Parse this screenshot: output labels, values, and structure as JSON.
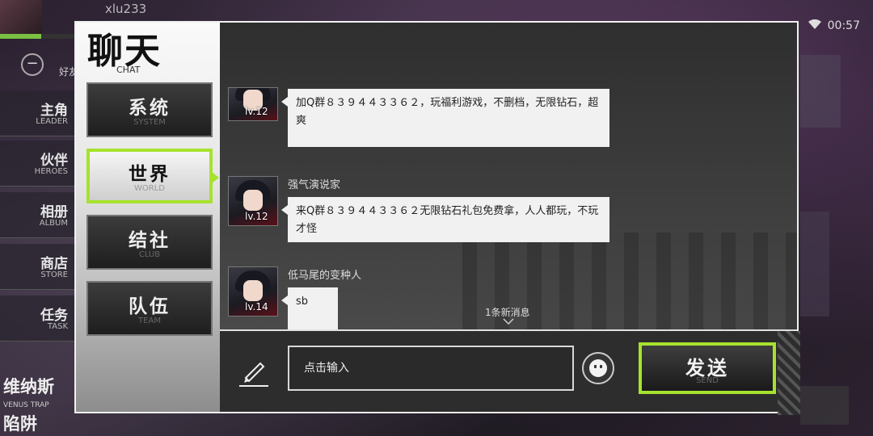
{
  "background": {
    "username": "xlu233",
    "time": "00:57",
    "friend_label": "好友",
    "menu": [
      {
        "title": "主角",
        "sub": "LEADER"
      },
      {
        "title": "伙伴",
        "sub": "HEROES"
      },
      {
        "title": "相册",
        "sub": "ALBUM"
      },
      {
        "title": "商店",
        "sub": "STORE"
      },
      {
        "title": "任务",
        "sub": "TASK"
      }
    ],
    "logo_title": "维纳斯",
    "logo_sub": "VENUS TRAP",
    "logo_title2": "陷阱"
  },
  "chat_panel": {
    "title": "聊天",
    "title_sub": "CHAT",
    "tabs": [
      {
        "label": "系统",
        "sub": "SYSTEM",
        "active": false
      },
      {
        "label": "世界",
        "sub": "WORLD",
        "active": true
      },
      {
        "label": "结社",
        "sub": "CLUB",
        "active": false
      },
      {
        "label": "队伍",
        "sub": "TEAM",
        "active": false
      }
    ],
    "messages": [
      {
        "user": "",
        "level": "lv.12",
        "text": "加Q群８３９４４３３６２，玩福利游戏，不删档，无限钻石，超爽"
      },
      {
        "user": "强气演说家",
        "level": "lv.12",
        "text": "来Q群８３９４４３３６２无限钻石礼包免费拿，人人都玩，不玩才怪"
      },
      {
        "user": "低马尾的变种人",
        "level": "lv.14",
        "text": "sb"
      }
    ],
    "new_messages": "1条新消息",
    "input_placeholder": "点击输入",
    "send_label": "发送",
    "send_sub": "SEND",
    "accent_color": "#a6e22e"
  }
}
